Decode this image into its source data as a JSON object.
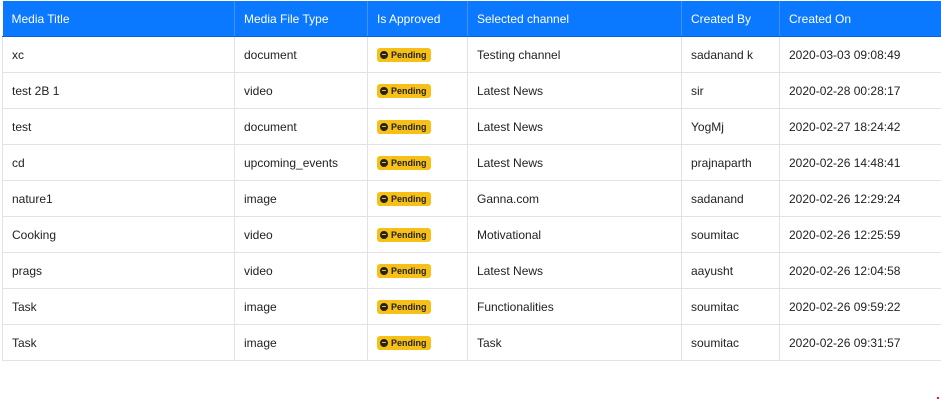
{
  "table": {
    "headers": [
      "Media Title",
      "Media File Type",
      "Is Approved",
      "Selected channel",
      "Created By",
      "Created On"
    ],
    "rows": [
      {
        "title": "xc",
        "type": "document",
        "status": "Pending",
        "channel": "Testing channel",
        "created_by": "sadanand k",
        "created_on": "2020-03-03 09:08:49"
      },
      {
        "title": "test 2B 1",
        "type": "video",
        "status": "Pending",
        "channel": "Latest News",
        "created_by": "sir",
        "created_on": "2020-02-28 00:28:17"
      },
      {
        "title": "test",
        "type": "document",
        "status": "Pending",
        "channel": "Latest News",
        "created_by": "YogMj",
        "created_on": "2020-02-27 18:24:42"
      },
      {
        "title": "cd",
        "type": "upcoming_events",
        "status": "Pending",
        "channel": "Latest News",
        "created_by": "prajnaparth",
        "created_on": "2020-02-26 14:48:41"
      },
      {
        "title": "nature1",
        "type": "image",
        "status": "Pending",
        "channel": "Ganna.com",
        "created_by": "sadanand",
        "created_on": "2020-02-26 12:29:24"
      },
      {
        "title": "Cooking",
        "type": "video",
        "status": "Pending",
        "channel": "Motivational",
        "created_by": "soumitac",
        "created_on": "2020-02-26 12:25:59"
      },
      {
        "title": "prags",
        "type": "video",
        "status": "Pending",
        "channel": "Latest News",
        "created_by": "aayusht",
        "created_on": "2020-02-26 12:04:58"
      },
      {
        "title": "Task",
        "type": "image",
        "status": "Pending",
        "channel": "Functionalities",
        "created_by": "soumitac",
        "created_on": "2020-02-26 09:59:22"
      },
      {
        "title": "Task",
        "type": "image",
        "status": "Pending",
        "channel": "Task",
        "created_by": "soumitac",
        "created_on": "2020-02-26 09:31:57"
      }
    ]
  },
  "colors": {
    "header_bg": "#0a78ff",
    "pending_badge": "#f6c017"
  },
  "icons": {
    "pending": "minus-circle-icon"
  }
}
